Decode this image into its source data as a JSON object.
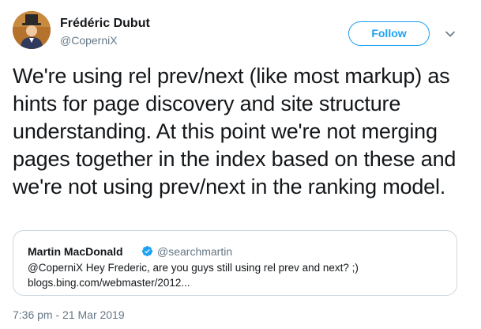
{
  "author": {
    "name": "Frédéric Dubut",
    "handle": "@CoperniX",
    "avatar_icon": "avatar-illustration"
  },
  "follow_button": {
    "label": "Follow",
    "color": "#1da1f2"
  },
  "menu": {
    "icon": "chevron-down-icon"
  },
  "tweet": {
    "text": "We're using rel prev/next (like most markup) as hints for page discovery and site structure understanding. At this point we're not merging pages together in the index based on these and we're not using prev/next in the ranking model."
  },
  "quoted_tweet": {
    "name": "Martin MacDonald",
    "verified_icon": "verified-badge-icon",
    "handle": "@searchmartin",
    "text_line1": "@CoperniX Hey Frederic, are you guys still using rel prev and next? ;)",
    "text_line2": "blogs.bing.com/webmaster/2012..."
  },
  "timestamp": "7:36 pm - 21 Mar 2019",
  "colors": {
    "text_primary": "#14171a",
    "text_secondary": "#657786",
    "accent": "#1da1f2",
    "border": "#ccd6dd"
  }
}
